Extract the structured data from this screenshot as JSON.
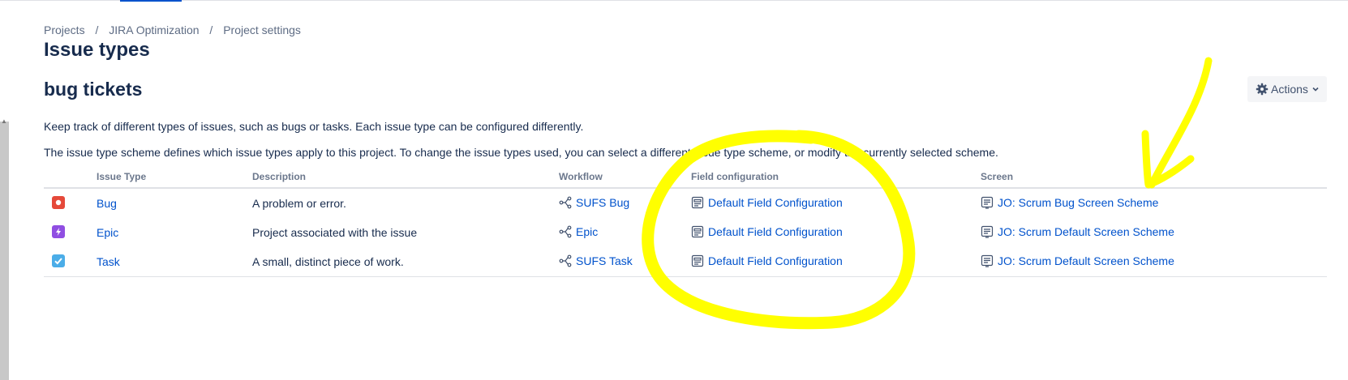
{
  "breadcrumb": {
    "items": [
      "Projects",
      "JIRA Optimization",
      "Project settings"
    ],
    "separator": "/"
  },
  "page": {
    "title": "Issue types",
    "scheme_title": "bug tickets"
  },
  "actions": {
    "label": "Actions",
    "icon": "gear-icon",
    "chevron": "chevron-down-icon"
  },
  "descriptions": {
    "line1": "Keep track of different types of issues, such as bugs or tasks. Each issue type can be configured differently.",
    "line2": "The issue type scheme defines which issue types apply to this project. To change the issue types used, you can select a different issue type scheme, or modify the currently selected scheme."
  },
  "table": {
    "headers": {
      "issue_type": "Issue Type",
      "description": "Description",
      "workflow": "Workflow",
      "field_configuration": "Field configuration",
      "screen": "Screen"
    },
    "rows": [
      {
        "icon": "bug-icon",
        "icon_color": "#e5493a",
        "issue_type": "Bug",
        "description": "A problem or error.",
        "workflow": "SUFS Bug",
        "field_configuration": "Default Field Configuration",
        "screen": "JO: Scrum Bug Screen Scheme"
      },
      {
        "icon": "epic-icon",
        "icon_color": "#904ee2",
        "issue_type": "Epic",
        "description": "Project associated with the issue",
        "workflow": "Epic",
        "field_configuration": "Default Field Configuration",
        "screen": "JO: Scrum Default Screen Scheme"
      },
      {
        "icon": "task-icon",
        "icon_color": "#4bade8",
        "issue_type": "Task",
        "description": "A small, distinct piece of work.",
        "workflow": "SUFS Task",
        "field_configuration": "Default Field Configuration",
        "screen": "JO: Scrum Default Screen Scheme"
      }
    ]
  },
  "colors": {
    "link": "#0052cc",
    "text": "#172b4d",
    "muted": "#6b778c",
    "annotation": "#ffff00"
  }
}
